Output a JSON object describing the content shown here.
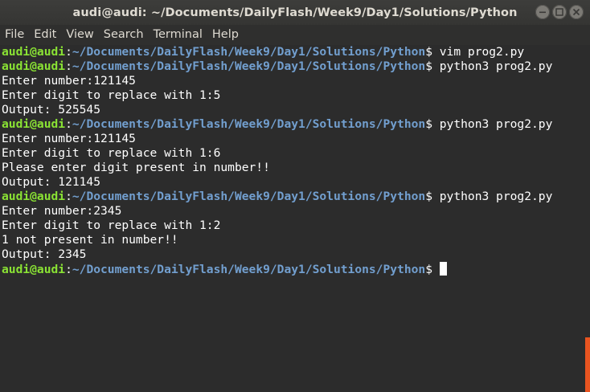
{
  "window": {
    "title": "audi@audi: ~/Documents/DailyFlash/Week9/Day1/Solutions/Python"
  },
  "menu": [
    "File",
    "Edit",
    "View",
    "Search",
    "Terminal",
    "Help"
  ],
  "prompt": {
    "user": "audi@audi",
    "colon": ":",
    "path": "~/Documents/DailyFlash/Week9/Day1/Solutions/Python",
    "dollar": "$"
  },
  "lines": [
    {
      "type": "prompt",
      "cmd": " vim prog2.py"
    },
    {
      "type": "prompt",
      "cmd": " python3 prog2.py"
    },
    {
      "type": "output",
      "text": "Enter number:121145"
    },
    {
      "type": "output",
      "text": "Enter digit to replace with 1:5"
    },
    {
      "type": "output",
      "text": "Output: 525545"
    },
    {
      "type": "prompt",
      "cmd": " python3 prog2.py"
    },
    {
      "type": "output",
      "text": "Enter number:121145"
    },
    {
      "type": "output",
      "text": "Enter digit to replace with 1:6"
    },
    {
      "type": "output",
      "text": "Please enter digit present in number!!"
    },
    {
      "type": "output",
      "text": "Output: 121145"
    },
    {
      "type": "prompt",
      "cmd": " python3 prog2.py"
    },
    {
      "type": "output",
      "text": "Enter number:2345"
    },
    {
      "type": "output",
      "text": "Enter digit to replace with 1:2"
    },
    {
      "type": "output",
      "text": "1 not present in number!!"
    },
    {
      "type": "output",
      "text": "Output: 2345"
    },
    {
      "type": "prompt",
      "cmd": " ",
      "cursor": true
    }
  ],
  "colors": {
    "user": "#8ae234",
    "path": "#729fcf",
    "background": "#2c2c2c",
    "scroll_accent": "#e95420"
  }
}
